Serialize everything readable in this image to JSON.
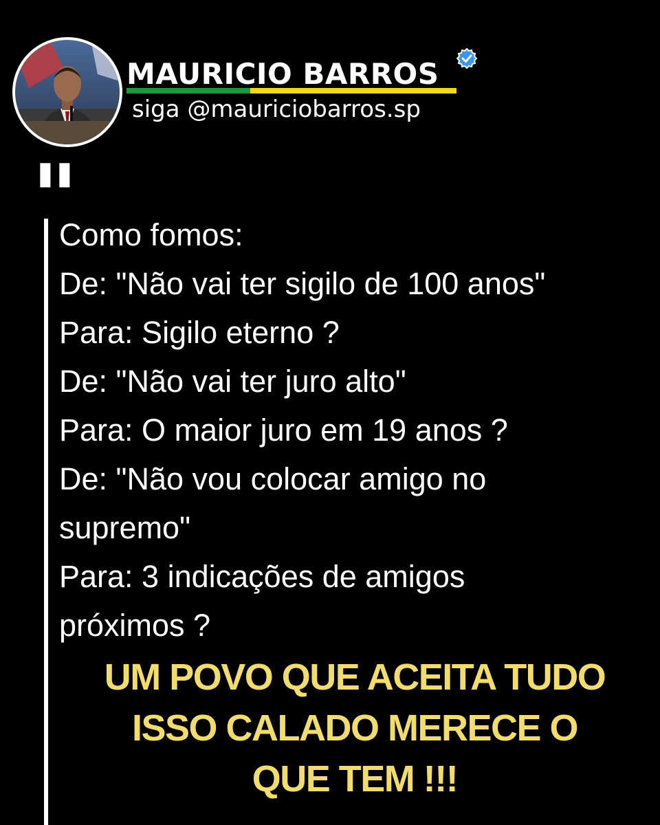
{
  "profile": {
    "name": "MAURICIO BARROS",
    "handle": "siga @mauriciobarros.sp",
    "verified_color": "#3897f0",
    "underline_colors": {
      "green": "#1a9a3a",
      "yellow": "#f5d90a"
    }
  },
  "post": {
    "quote_mark": "\"",
    "lines": [
      "Como fomos:",
      "De: \"Não vai ter sigilo de 100 anos\"",
      "Para: Sigilo eterno ?",
      "De: \"Não vai ter juro alto\"",
      "Para: O maior juro em 19 anos ?",
      "De: \"Não vou colocar amigo no",
      "supremo\"",
      "Para: 3 indicações de amigos",
      "próximos ?"
    ],
    "conclusion_lines": [
      "UM POVO QUE ACEITA TUDO",
      "ISSO CALADO MERECE O",
      "QUE TEM !!!"
    ],
    "conclusion_color": "#f2dc6a"
  }
}
